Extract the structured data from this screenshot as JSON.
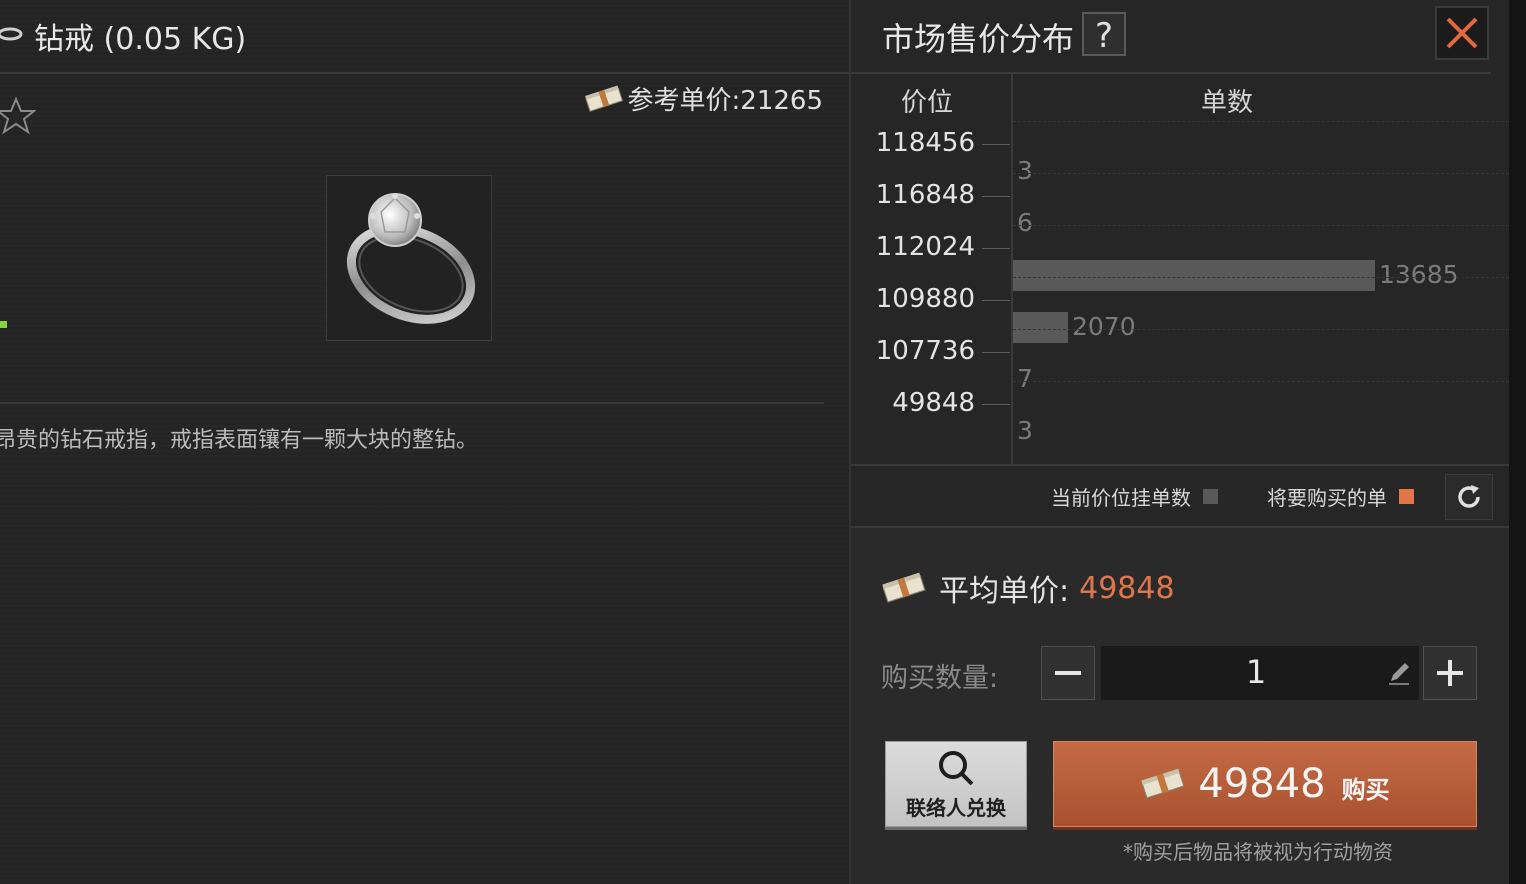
{
  "item": {
    "title": "钻戒 (0.05 KG)",
    "reference_price": "参考单价:21265",
    "description": "昂贵的钻石戒指，戒指表面镶有一颗大块的整钻。"
  },
  "market": {
    "title": "市场售价分布",
    "help_label": "?",
    "col_price": "价位",
    "col_count": "单数",
    "legend_current": "当前价位挂单数",
    "legend_buy": "将要购买的单",
    "colors": {
      "current": "#59595a",
      "buy": "#e0764a"
    }
  },
  "chart_data": {
    "type": "bar",
    "orientation": "horizontal",
    "categories": [
      "118456",
      "116848",
      "112024",
      "109880",
      "107736",
      "49848"
    ],
    "values": [
      3,
      6,
      13685,
      2070,
      7,
      3
    ],
    "xlabel": "单数",
    "ylabel": "价位"
  },
  "purchase": {
    "avg_label": "平均单价:",
    "avg_value": "49848",
    "qty_label": "购买数量:",
    "qty_value": "1",
    "contact_label": "联络人兑换",
    "buy_price": "49848",
    "buy_label": "购买",
    "note": "*购买后物品将被视为行动物资"
  }
}
